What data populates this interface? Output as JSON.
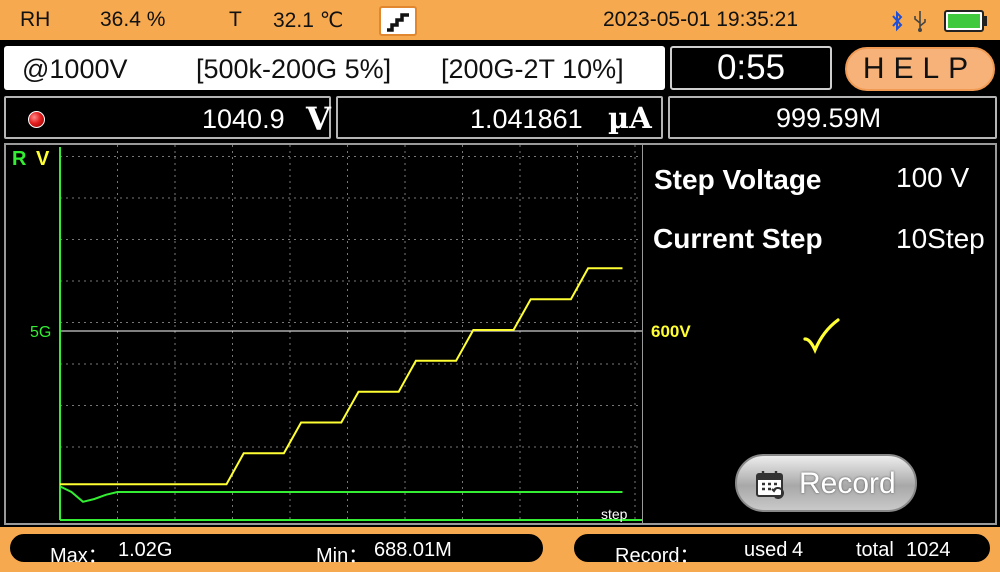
{
  "status": {
    "rh_label": "RH",
    "rh_value": "36.4 %",
    "temp_label": "T",
    "temp_value": "32.1 ℃",
    "mode_icon": "step-icon",
    "datetime": "2023-05-01 19:35:21",
    "icons": [
      "bluetooth-icon",
      "usb-icon",
      "battery-icon"
    ],
    "battery_color": "#3ec93e"
  },
  "range": {
    "voltage": "@1000V",
    "range1": "[500k-200G  5%]",
    "range2": "[200G-2T  10%]"
  },
  "timer": "0:55",
  "help_label": "HELP",
  "readings": {
    "voltage_value": "1040.9",
    "voltage_unit": "V",
    "current_value": "1.041861",
    "current_unit": "µA",
    "resistance_value": "999.59M"
  },
  "side": {
    "step_voltage_label": "Step Voltage",
    "step_voltage_value": "100 V",
    "current_step_label": "Current Step",
    "current_step_value": "10Step",
    "record_label": "Record"
  },
  "chart_data": {
    "type": "line",
    "axis_label_r": "R",
    "axis_label_v": "V",
    "xlabel": "step",
    "r_marker_label": "5G",
    "v_marker_label": "600V",
    "xlim": [
      0,
      10
    ],
    "ylim_v": [
      0,
      1200
    ],
    "grid": true,
    "colors": {
      "voltage": "#ffff33",
      "resistance": "#33ee33",
      "grid": "#777777",
      "axis": "#33ee33",
      "marker_line": "#ffffff"
    },
    "series": [
      {
        "key": "voltage",
        "x": [
          0,
          2.9,
          3.2,
          3.9,
          4.2,
          4.9,
          5.2,
          5.9,
          6.2,
          6.9,
          7.2,
          7.9,
          8.2,
          8.9,
          9.2,
          9.8
        ],
        "values": [
          100,
          100,
          200,
          200,
          300,
          300,
          400,
          400,
          500,
          500,
          600,
          600,
          700,
          700,
          800,
          800
        ]
      },
      {
        "key": "resistance",
        "x": [
          0,
          0.2,
          0.4,
          0.6,
          0.8,
          1.0,
          9.8
        ],
        "values": [
          0.24,
          0.2,
          0.13,
          0.15,
          0.18,
          0.2,
          0.2
        ]
      }
    ]
  },
  "footer": {
    "max_label": "Max：",
    "max_value": "1.02G",
    "min_label": "Min：",
    "min_value": "688.01M",
    "record_label": "Record：",
    "used_label": "used",
    "used_value": "4",
    "total_label": "total",
    "total_value": "1024"
  }
}
